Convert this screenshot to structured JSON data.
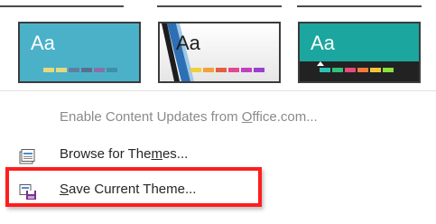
{
  "theme_gallery": {
    "themes": [
      {
        "sample_text": "Aa",
        "swatch_colors": [
          "#e7d97c",
          "#e7d97c",
          "#5e7fa3",
          "#5a6f8e",
          "#8a6fa8",
          "#3e8fa8"
        ]
      },
      {
        "sample_text": "Aa",
        "swatch_colors": [
          "#f0cf3c",
          "#f0a23c",
          "#e45d3c",
          "#e04a8e",
          "#c43fbf",
          "#9b3fcf"
        ]
      },
      {
        "sample_text": "Aa",
        "swatch_colors": [
          "#2bc2b6",
          "#2ec27a",
          "#e84a7a",
          "#f27a3c",
          "#f2c43c",
          "#8ae23c"
        ]
      }
    ]
  },
  "menu": {
    "enable_updates": {
      "label_pre": "Enable Content Updates from ",
      "label_u": "O",
      "label_post": "ffice.com..."
    },
    "browse": {
      "label_pre": "Browse for The",
      "label_u": "m",
      "label_post": "es..."
    },
    "save": {
      "label_pre": "",
      "label_u": "S",
      "label_post": "ave Current Theme..."
    }
  },
  "colors": {
    "highlight_border": "#ff1e1e",
    "theme1_background": "#4bb1c9",
    "theme3_background": "#1ba69f"
  }
}
